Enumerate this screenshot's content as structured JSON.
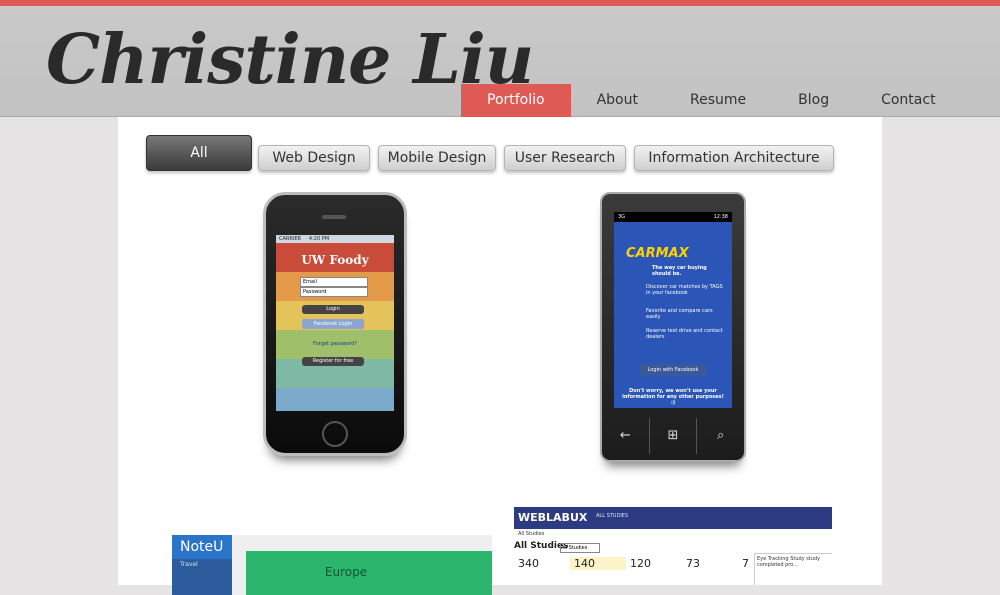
{
  "site": {
    "title": "Christine Liu"
  },
  "nav": {
    "items": [
      {
        "label": "Portfolio",
        "active": true
      },
      {
        "label": "About"
      },
      {
        "label": "Resume"
      },
      {
        "label": "Blog"
      },
      {
        "label": "Contact"
      }
    ]
  },
  "filters": [
    "All",
    "Web Design",
    "Mobile Design",
    "User Research",
    "Information Architecture"
  ],
  "portfolio": {
    "uw_foody": {
      "status": "CARRIER",
      "time": "4:20 PM",
      "title": "UW Foody",
      "email": "Email",
      "password": "Password",
      "login": "Login",
      "facebook": "Facebook Login",
      "forgot": "Forget password?",
      "register": "Register for free"
    },
    "carmax": {
      "signal": "3G",
      "time": "12:38",
      "logo": "CARMAX",
      "tagline": "The way car buying should be.",
      "feature1": "Discover car matches by TAGS in your facebook",
      "feature2": "Favorite and compare cars easily",
      "feature3": "Reserve test drive and contact dealers",
      "fb_button": "Login with Facebook",
      "footer": "Don't worry, we won't use your information for any other purposes! :)"
    },
    "noteu": {
      "brand": "NoteU",
      "menu": "Travel",
      "main": "Europe"
    },
    "weblabux": {
      "brand": "WEBLABUX",
      "tab": "ALL STUDIES",
      "breadcrumb": "All Studies",
      "heading": "All Studies",
      "select": "All Studies",
      "stats": [
        "340",
        "140",
        "120",
        "73",
        "7"
      ],
      "panel": "Eye Tracking Study study completed pro..."
    }
  }
}
